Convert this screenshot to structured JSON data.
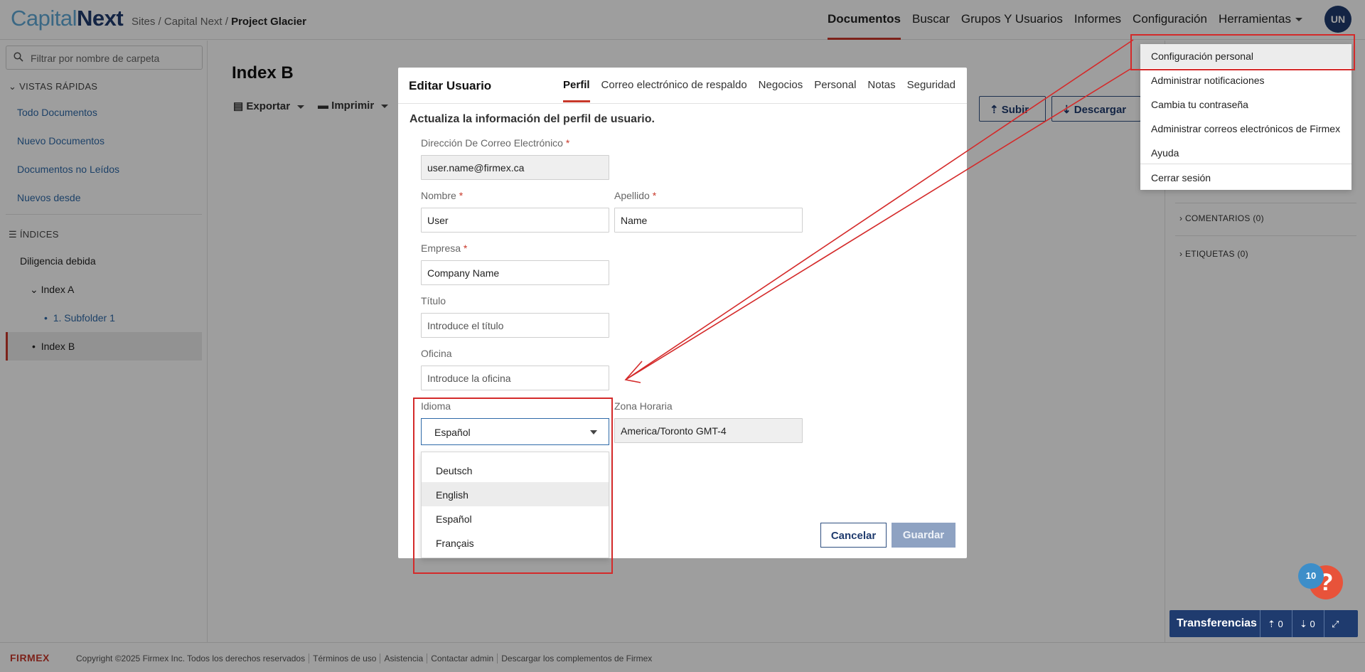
{
  "header": {
    "logo_part1": "Capital",
    "logo_part2": "Next",
    "breadcrumb": [
      "Sites",
      "Capital Next",
      "Project Glacier"
    ],
    "nav": [
      "Documentos",
      "Buscar",
      "Grupos Y Usuarios",
      "Informes",
      "Configuración",
      "Herramientas"
    ],
    "avatar": "UN"
  },
  "sidebar": {
    "filter_placeholder": "Filtrar por nombre de carpeta",
    "quick_views_title": "VISTAS RÁPIDAS",
    "quick_views": [
      "Todo Documentos",
      "Nuevo Documentos",
      "Documentos no Leídos",
      "Nuevos desde"
    ],
    "indexes_title": "ÍNDICES",
    "tree": [
      "Diligencia debida",
      "Index A",
      "1. Subfolder 1",
      "Index B"
    ]
  },
  "main": {
    "title": "Index B",
    "export_label": "Exportar",
    "print_label": "Imprimir",
    "upload_label": "Subir",
    "download_label": "Descargar"
  },
  "right_panel": {
    "comments": "COMENTARIOS (0)",
    "tags": "ETIQUETAS (0)"
  },
  "modal": {
    "title": "Editar Usuario",
    "tabs": [
      "Perfil",
      "Correo electrónico de respaldo",
      "Negocios",
      "Personal",
      "Notas",
      "Seguridad"
    ],
    "subtitle": "Actualiza la información del perfil de usuario.",
    "email_label": "Dirección De Correo Electrónico",
    "email_value": "user.name@firmex.ca",
    "first_name_label": "Nombre",
    "first_name_value": "User",
    "last_name_label": "Apellido",
    "last_name_value": "Name",
    "company_label": "Empresa",
    "company_value": "Company Name",
    "title_label": "Título",
    "title_placeholder": "Introduce el título",
    "office_label": "Oficina",
    "office_placeholder": "Introduce la oficina",
    "language_label": "Idioma",
    "language_value": "Español",
    "language_options": [
      "Deutsch",
      "English",
      "Español",
      "Français"
    ],
    "timezone_label": "Zona Horaria",
    "timezone_value": "America/Toronto  GMT-4",
    "cancel_label": "Cancelar",
    "save_label": "Guardar",
    "required_mark": "*"
  },
  "user_menu": {
    "items": [
      "Configuración personal",
      "Administrar notificaciones",
      "Cambia tu contraseña",
      "Administrar correos electrónicos de Firmex",
      "Ayuda",
      "Cerrar sesión"
    ]
  },
  "transfers": {
    "label": "Transferencias",
    "uploads": "0",
    "downloads": "0"
  },
  "help": {
    "badge": "10",
    "icon_glyph": "?"
  },
  "footer": {
    "brand": "FIRMEX",
    "links": [
      "Copyright ©2025 Firmex Inc. Todos los derechos reservados",
      "Términos de uso",
      "Asistencia",
      "Contactar admin",
      "Descargar los complementos de Firmex"
    ]
  },
  "colors": {
    "brand_navy": "#1f3b6e",
    "accent_red": "#c8382a",
    "link_blue": "#2f6aa8",
    "annotation_red": "#d42a2a"
  }
}
